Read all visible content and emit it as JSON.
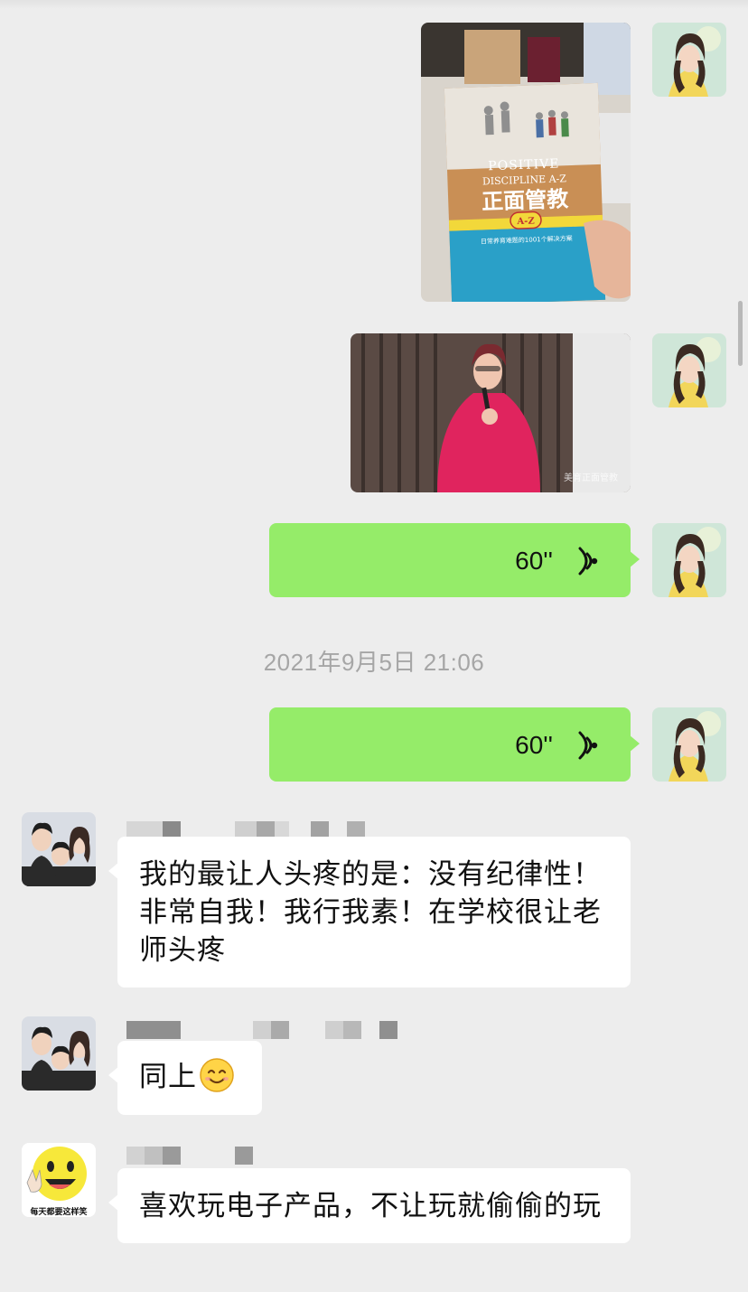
{
  "chat": {
    "image1": {
      "book_line1": "POSITIVE",
      "book_line2": "DISCIPLINE A-Z",
      "book_title_cn": "正面管教",
      "book_badge": "A-Z",
      "book_tagline": "日常养育难题的1001个解决方案"
    },
    "image2": {
      "watermark": "美育正面管教"
    },
    "voice1": {
      "duration": "60''"
    },
    "timestamp": "2021年9月5日 21:06",
    "voice2": {
      "duration": "60''"
    },
    "msg1": {
      "text": "我的最让人头疼的是：没有纪律性！非常自我！我行我素！在学校很让老师头疼"
    },
    "msg2": {
      "text": "同上"
    },
    "msg3": {
      "text": "喜欢玩电子产品，不让玩就偷偷的玩"
    },
    "avatar3": {
      "caption": "每天都要这样笑"
    }
  },
  "icons": {
    "voice": "voice-wave-icon",
    "emoji": "smile-emoji-icon"
  },
  "colors": {
    "background": "#ededed",
    "sent_bubble": "#95ec69",
    "received_bubble": "#ffffff",
    "timestamp": "#a6a6a6"
  }
}
